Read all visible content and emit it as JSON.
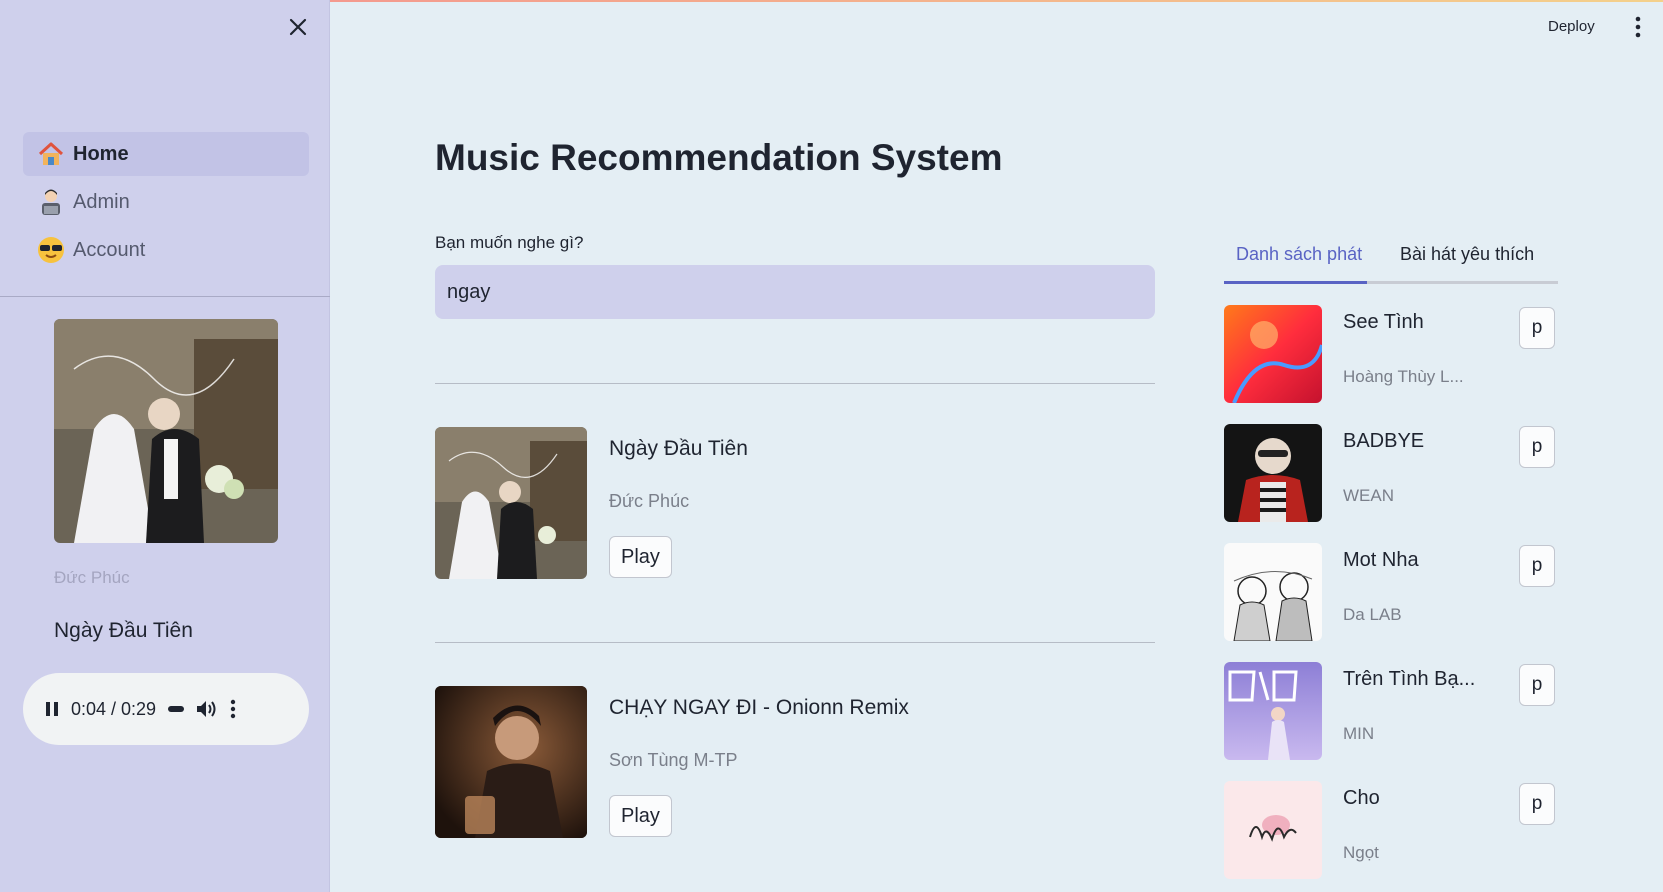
{
  "header": {
    "deploy_label": "Deploy",
    "menu_icon": "kebab-menu-icon"
  },
  "sidebar": {
    "close_icon": "close-icon",
    "nav": [
      {
        "label": "Home",
        "icon": "house-icon",
        "active": true
      },
      {
        "label": "Admin",
        "icon": "office-worker-icon",
        "active": false
      },
      {
        "label": "Account",
        "icon": "sunglasses-face-icon",
        "active": false
      }
    ],
    "now_playing": {
      "artist": "Đức Phúc",
      "title": "Ngày Đầu Tiên",
      "time": "0:04 / 0:29"
    }
  },
  "main": {
    "title": "Music Recommendation System",
    "search": {
      "label": "Bạn muốn nghe gì?",
      "value": "ngay"
    },
    "results": [
      {
        "title": "Ngày Đầu Tiên",
        "artist": "Đức Phúc",
        "button": "Play"
      },
      {
        "title": "CHẠY NGAY ĐI - Onionn Remix",
        "artist": "Sơn Tùng M-TP",
        "button": "Play"
      }
    ]
  },
  "right_panel": {
    "tabs": [
      {
        "label": "Danh sách phát",
        "active": true
      },
      {
        "label": "Bài hát yêu thích",
        "active": false
      }
    ],
    "playlist": [
      {
        "title": "See Tình",
        "artist": "Hoàng Thùy L...",
        "button": "p"
      },
      {
        "title": "BADBYE",
        "artist": "WEAN",
        "button": "p"
      },
      {
        "title": "Mot Nha",
        "artist": "Da LAB",
        "button": "p"
      },
      {
        "title": "Trên Tình Bạ...",
        "artist": "MIN",
        "button": "p"
      },
      {
        "title": "Cho",
        "artist": "Ngọt",
        "button": "p"
      }
    ]
  },
  "colors": {
    "accent": "#5963c4",
    "sidebar_bg": "#cfd0ec",
    "main_bg": "#e4eef4"
  }
}
